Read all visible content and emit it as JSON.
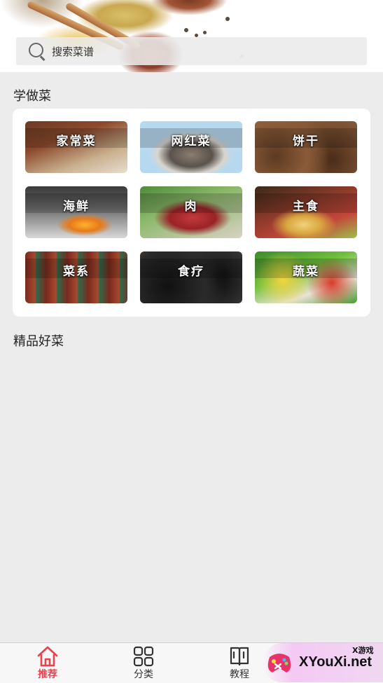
{
  "search": {
    "placeholder": "搜索菜谱"
  },
  "sections": {
    "learn_title": "学做菜",
    "featured_title": "精品好菜"
  },
  "categories": [
    {
      "label": "家常菜",
      "icon": "braised-meat-photo"
    },
    {
      "label": "网红菜",
      "icon": "spice-bowl-photo"
    },
    {
      "label": "饼干",
      "icon": "cookies-photo"
    },
    {
      "label": "海鲜",
      "icon": "seafood-photo"
    },
    {
      "label": "肉",
      "icon": "raw-meat-photo"
    },
    {
      "label": "主食",
      "icon": "noodles-photo"
    },
    {
      "label": "菜系",
      "icon": "pork-belly-photo"
    },
    {
      "label": "食疗",
      "icon": "black-beans-photo"
    },
    {
      "label": "蔬菜",
      "icon": "vegetables-photo"
    }
  ],
  "tabbar": {
    "tabs": [
      {
        "label": "推荐",
        "icon": "home-icon",
        "active": true
      },
      {
        "label": "分类",
        "icon": "grid-icon",
        "active": false
      },
      {
        "label": "教程",
        "icon": "book-icon",
        "active": false
      }
    ]
  },
  "watermark": {
    "brand": "XYouXi.net",
    "sub": "X游戏"
  },
  "colors": {
    "accent": "#e8424f",
    "page_bg": "#ececec",
    "panel_bg": "#ffffff"
  }
}
